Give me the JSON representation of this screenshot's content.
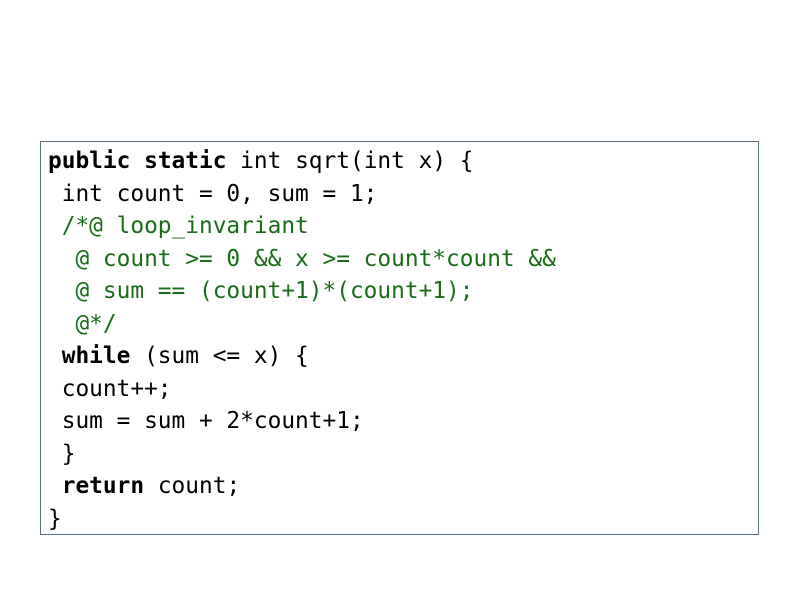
{
  "colors": {
    "border": "#5a7186",
    "text": "#000000",
    "comment": "#1a6b1a",
    "background": "#ffffff"
  },
  "code": {
    "language": "java",
    "lines": [
      {
        "indent": "",
        "segments": [
          {
            "type": "keyword",
            "text": "public"
          },
          {
            "type": "plain",
            "text": " "
          },
          {
            "type": "keyword",
            "text": "static"
          },
          {
            "type": "plain",
            "text": " int sqrt(int x) {"
          }
        ]
      },
      {
        "indent": " ",
        "segments": [
          {
            "type": "plain",
            "text": "int count = 0, sum = 1;"
          }
        ]
      },
      {
        "indent": " ",
        "segments": [
          {
            "type": "comment",
            "text": "/*@ loop_invariant"
          }
        ]
      },
      {
        "indent": "  ",
        "segments": [
          {
            "type": "comment",
            "text": "@ count >= 0 && x >= count*count &&"
          }
        ]
      },
      {
        "indent": "  ",
        "segments": [
          {
            "type": "comment",
            "text": "@ sum == (count+1)*(count+1);"
          }
        ]
      },
      {
        "indent": "  ",
        "segments": [
          {
            "type": "comment",
            "text": "@*/"
          }
        ]
      },
      {
        "indent": " ",
        "segments": [
          {
            "type": "keyword",
            "text": "while"
          },
          {
            "type": "plain",
            "text": " (sum <= x) {"
          }
        ]
      },
      {
        "indent": " ",
        "segments": [
          {
            "type": "plain",
            "text": "count++;"
          }
        ]
      },
      {
        "indent": " ",
        "segments": [
          {
            "type": "plain",
            "text": "sum = sum + 2*count+1;"
          }
        ]
      },
      {
        "indent": " ",
        "segments": [
          {
            "type": "plain",
            "text": "}"
          }
        ]
      },
      {
        "indent": " ",
        "segments": [
          {
            "type": "keyword",
            "text": "return"
          },
          {
            "type": "plain",
            "text": " count;"
          }
        ]
      },
      {
        "indent": "",
        "segments": [
          {
            "type": "plain",
            "text": "}"
          }
        ]
      }
    ]
  }
}
